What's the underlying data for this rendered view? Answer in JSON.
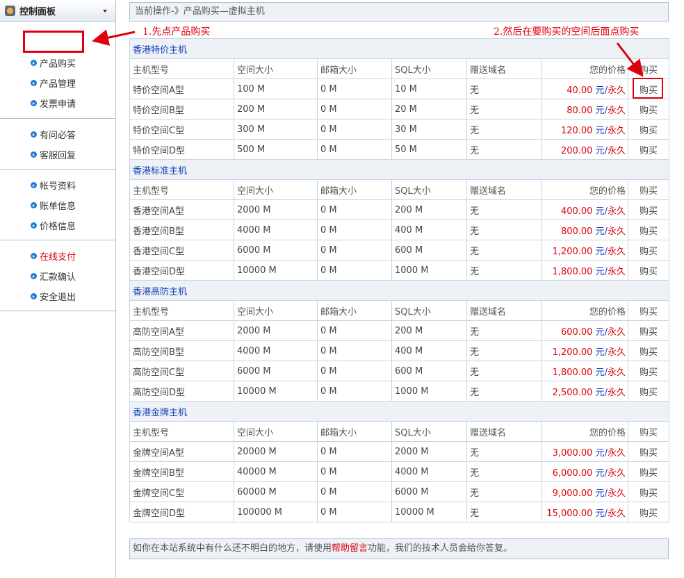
{
  "sidebar": {
    "title": "控制面板",
    "groups": [
      [
        "产品购买",
        "产品管理",
        "发票申请"
      ],
      [
        "有问必答",
        "客服回复"
      ],
      [
        "帐号资料",
        "账单信息",
        "价格信息"
      ],
      [
        "在线支付",
        "汇款确认",
        "安全退出"
      ]
    ]
  },
  "breadcrumb": "当前操作-》产品购买—虚拟主机",
  "annotations": {
    "step1": "1.先点产品购买",
    "step2": "2.然后在要购买的空间后面点购买"
  },
  "table": {
    "headers": [
      "主机型号",
      "空间大小",
      "邮箱大小",
      "SQL大小",
      "赠送域名",
      "您的价格",
      "购买"
    ],
    "price_unit": "元/",
    "price_term": "永久",
    "sections": [
      {
        "title": "香港特价主机",
        "rows": [
          [
            "特价空间A型",
            "100 M",
            "0 M",
            "10 M",
            "无",
            "40.00",
            "购买"
          ],
          [
            "特价空间B型",
            "200 M",
            "0 M",
            "20 M",
            "无",
            "80.00",
            "购买"
          ],
          [
            "特价空间C型",
            "300 M",
            "0 M",
            "30 M",
            "无",
            "120.00",
            "购买"
          ],
          [
            "特价空间D型",
            "500 M",
            "0 M",
            "50 M",
            "无",
            "200.00",
            "购买"
          ]
        ]
      },
      {
        "title": "香港标准主机",
        "rows": [
          [
            "香港空间A型",
            "2000 M",
            "0 M",
            "200 M",
            "无",
            "400.00",
            "购买"
          ],
          [
            "香港空间B型",
            "4000 M",
            "0 M",
            "400 M",
            "无",
            "800.00",
            "购买"
          ],
          [
            "香港空间C型",
            "6000 M",
            "0 M",
            "600 M",
            "无",
            "1,200.00",
            "购买"
          ],
          [
            "香港空间D型",
            "10000 M",
            "0 M",
            "1000 M",
            "无",
            "1,800.00",
            "购买"
          ]
        ]
      },
      {
        "title": "香港高防主机",
        "rows": [
          [
            "高防空间A型",
            "2000 M",
            "0 M",
            "200 M",
            "无",
            "600.00",
            "购买"
          ],
          [
            "高防空间B型",
            "4000 M",
            "0 M",
            "400 M",
            "无",
            "1,200.00",
            "购买"
          ],
          [
            "高防空间C型",
            "6000 M",
            "0 M",
            "600 M",
            "无",
            "1,800.00",
            "购买"
          ],
          [
            "高防空间D型",
            "10000 M",
            "0 M",
            "1000 M",
            "无",
            "2,500.00",
            "购买"
          ]
        ]
      },
      {
        "title": "香港金牌主机",
        "rows": [
          [
            "金牌空间A型",
            "20000 M",
            "0 M",
            "2000 M",
            "无",
            "3,000.00",
            "购买"
          ],
          [
            "金牌空间B型",
            "40000 M",
            "0 M",
            "4000 M",
            "无",
            "6,000.00",
            "购买"
          ],
          [
            "金牌空间C型",
            "60000 M",
            "0 M",
            "6000 M",
            "无",
            "9,000.00",
            "购买"
          ],
          [
            "金牌空间D型",
            "100000 M",
            "0 M",
            "10000 M",
            "无",
            "15,000.00",
            "购买"
          ]
        ]
      }
    ]
  },
  "footer": {
    "before": "如你在本站系统中有什么还不明白的地方，请使用",
    "link": "帮助留言",
    "after": "功能，我们的技术人员会给你答复。"
  },
  "colors": {
    "accent_red": "#e0000d",
    "link_blue": "#1340b8",
    "border": "#a9bfd6",
    "panel_bg": "#eef2f7"
  }
}
